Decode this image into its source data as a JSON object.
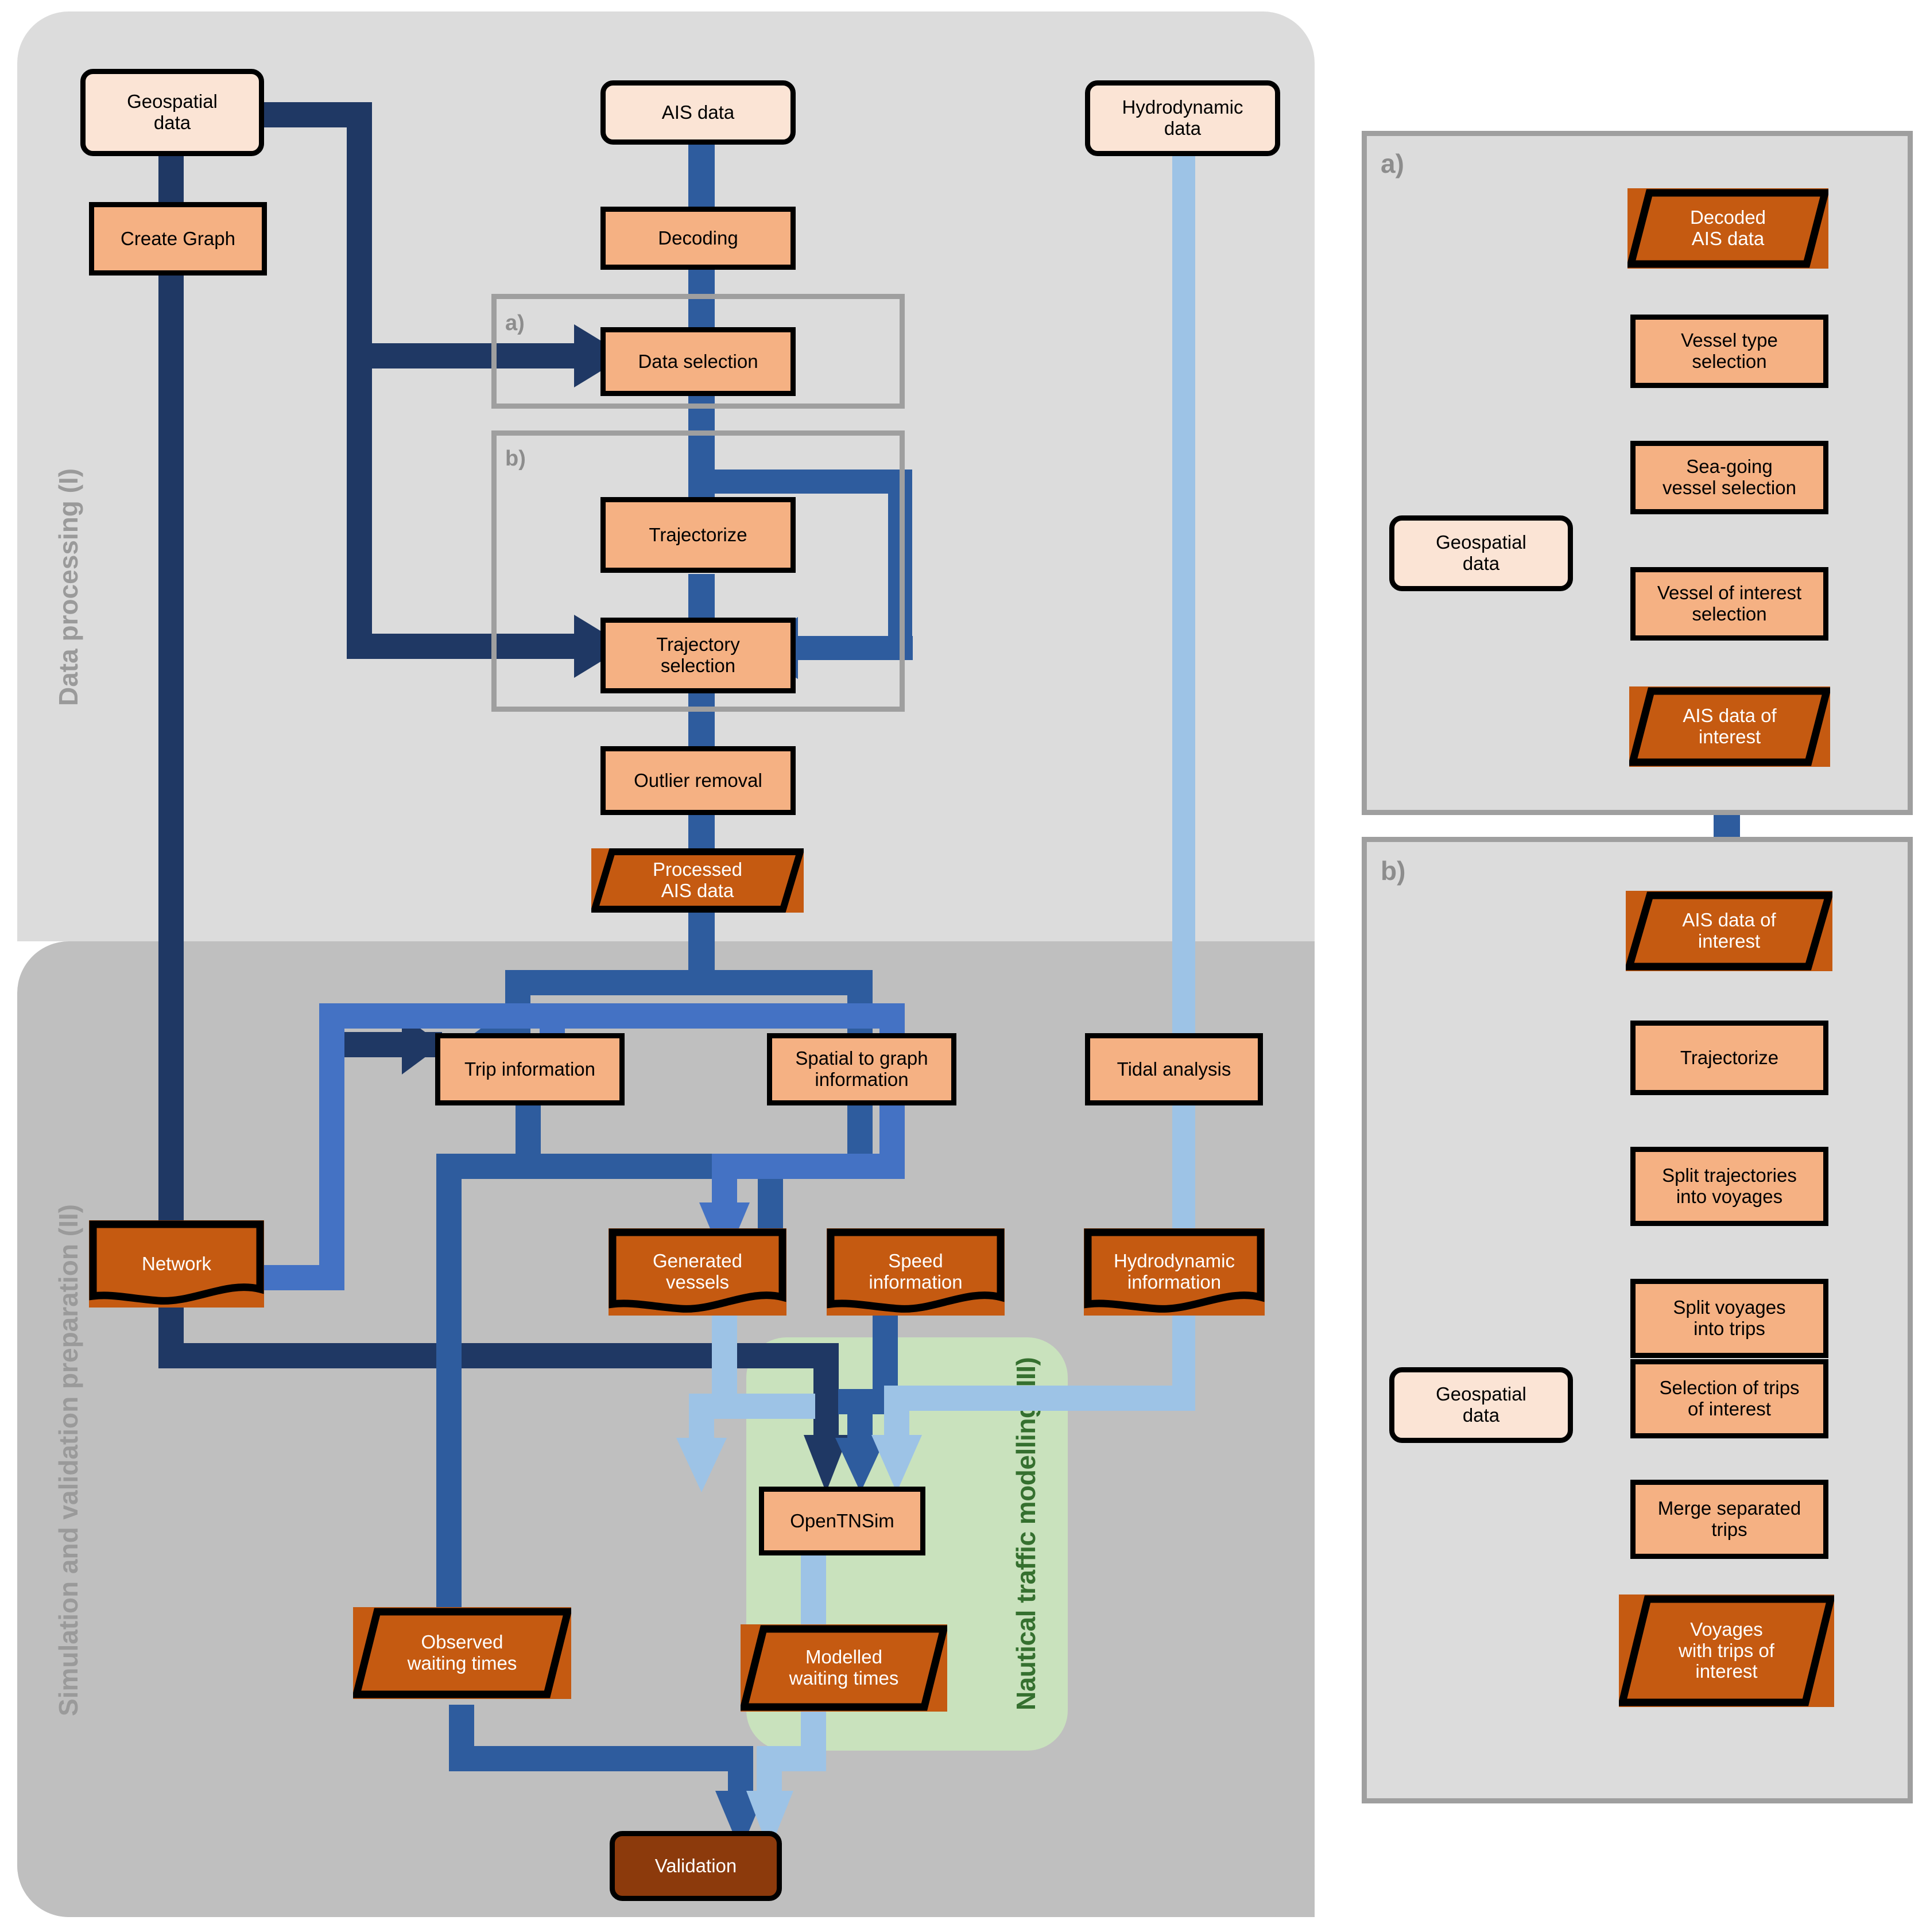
{
  "stages": {
    "data_processing": "Data processing (I)",
    "simulation": "Simulation and validation preparation (II)",
    "nautical": "Nautical traffic modelling (III)"
  },
  "colors": {
    "input_fill": "#fbe4d5",
    "process_fill": "#f5b183",
    "data_fill": "#c55a11",
    "terminal_fill": "#8c3a0c",
    "stage1_bg": "#dcdcdc",
    "stage2_bg": "#bfbfbf",
    "green_zone": "#c9e2bd",
    "green_text": "#35702f",
    "arrow_dark": "#1f3864",
    "arrow_mid": "#2e5c9e",
    "arrow_blue": "#4472c4",
    "arrow_light": "#9dc3e6",
    "panel_border": "#9f9f9f",
    "stage_label": "#9a9a9a"
  },
  "group_labels": {
    "a": "a)",
    "b": "b)"
  },
  "main_nodes": {
    "geospatial_data": "Geospatial\ndata",
    "create_graph": "Create Graph",
    "ais_data": "AIS data",
    "decoding": "Decoding",
    "data_selection": "Data selection",
    "trajectorize": "Trajectorize",
    "trajectory_selection": "Trajectory\nselection",
    "outlier_removal": "Outlier removal",
    "processed_ais_data": "Processed\nAIS data",
    "hydrodynamic_data": "Hydrodynamic\ndata",
    "trip_information": "Trip information",
    "spatial_to_graph_information": "Spatial to graph\ninformation",
    "tidal_analysis": "Tidal analysis",
    "network": "Network",
    "generated_vessels": "Generated\nvessels",
    "speed_information": "Speed\ninformation",
    "hydrodynamic_information": "Hydrodynamic\ninformation",
    "opentnsim": "OpenTNSim",
    "observed_waiting_times": "Observed\nwaiting times",
    "modelled_waiting_times": "Modelled\nwaiting times",
    "validation": "Validation"
  },
  "panel_a": {
    "letter": "a)",
    "decoded_ais_data": "Decoded\nAIS data",
    "vessel_type_selection": "Vessel type\nselection",
    "sea_going_vessel_selection": "Sea-going\nvessel selection",
    "vessel_of_interest_selection": "Vessel of interest\nselection",
    "geospatial_data": "Geospatial\ndata",
    "ais_data_of_interest": "AIS data of\ninterest"
  },
  "panel_b": {
    "letter": "b)",
    "ais_data_of_interest": "AIS data of\ninterest",
    "trajectorize": "Trajectorize",
    "split_trajectories_into_voyages": "Split trajectories\ninto voyages",
    "split_voyages_into_trips": "Split voyages\ninto trips",
    "selection_of_trips_of_interest": "Selection of trips\nof interest",
    "geospatial_data": "Geospatial\ndata",
    "merge_separated_trips": "Merge separated\ntrips",
    "voyages_with_trips_of_interest": "Voyages\nwith trips of\ninterest"
  }
}
